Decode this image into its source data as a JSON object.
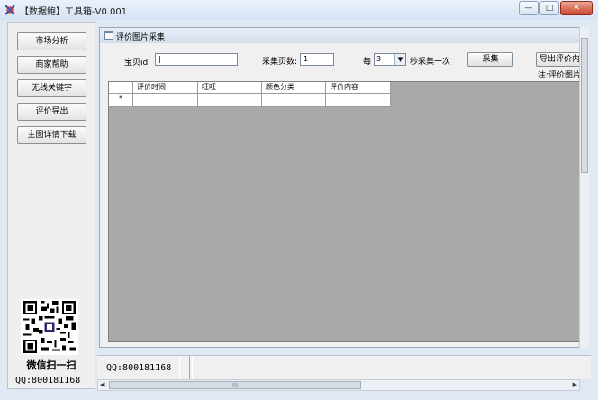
{
  "window": {
    "title": "【数据鲍】工具箱-V0.001",
    "controls": {
      "minimize": "—",
      "maximize": "□",
      "close": "✕"
    }
  },
  "sidebar": {
    "buttons": [
      "市场分析",
      "商家帮助",
      "无线关键字",
      "评价导出",
      "主图详情下载"
    ],
    "qr_caption": "微信扫一扫",
    "qq": "QQ:800181168"
  },
  "child_window": {
    "title": "评价图片采集",
    "item_id_label": "宝贝id",
    "item_id_value": "|",
    "pages_label": "采集页数:",
    "pages_value": "1",
    "every_label": "每",
    "interval_value": "3",
    "interval_suffix": "秒采集一次",
    "collect_button": "采集",
    "export_button": "导出评价内容",
    "note": "注:评价图片",
    "grid": {
      "columns": [
        "评价时间",
        "旺旺",
        "颜色分类",
        "评价内容"
      ],
      "new_row_marker": "*"
    }
  },
  "status": {
    "qq": "QQ:800181168"
  },
  "hscroll_grip": "III"
}
